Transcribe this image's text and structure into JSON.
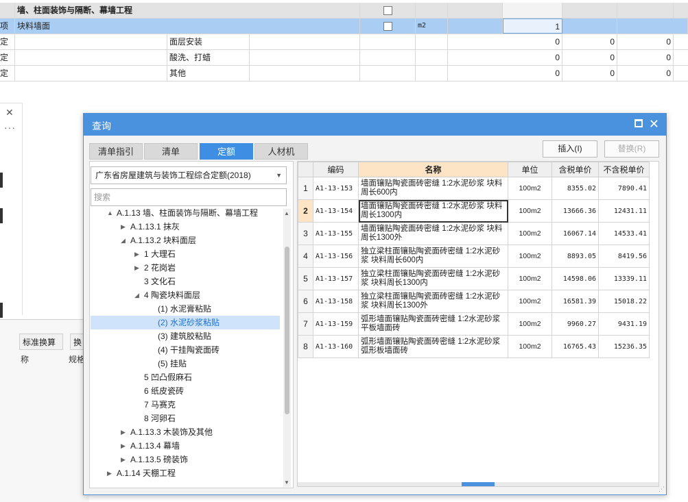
{
  "sheet": {
    "header_row": {
      "label": "墙、柱面装饰与隔断、幕墙工程"
    },
    "selected_row": {
      "type": "项",
      "name": "块料墙面",
      "unit": "m2",
      "qty": "1"
    },
    "rows": [
      {
        "type": "定",
        "desc": "面层安装",
        "v1": "0",
        "v2": "0",
        "v3": "0"
      },
      {
        "type": "定",
        "desc": "酸洗、打蜡",
        "v1": "0",
        "v2": "0",
        "v3": "0"
      },
      {
        "type": "定",
        "desc": "其他",
        "v1": "0",
        "v2": "0",
        "v3": "0"
      }
    ]
  },
  "side": {
    "close": "✕",
    "more": "···"
  },
  "bottom": {
    "tab1": "标准换算",
    "tab2": "换",
    "col1": "称",
    "col2": "规格"
  },
  "dialog": {
    "title": "查询",
    "tabs": [
      "清单指引",
      "清单",
      "定额",
      "人材机"
    ],
    "active_tab": 2,
    "insert_label": "插入(I)",
    "replace_label": "替换(R)",
    "quota_lib": "广东省房屋建筑与装饰工程综合定额(2018)",
    "search_placeholder": "搜索",
    "tree": [
      {
        "label": "A.1.13 墙、柱面装饰与隔断、幕墙工程",
        "level": 0,
        "toggle": "▲"
      },
      {
        "label": "A.1.13.1 抹灰",
        "level": 1,
        "toggle": "▶"
      },
      {
        "label": "A.1.13.2 块料面层",
        "level": 1,
        "toggle": "◢"
      },
      {
        "label": "1 大理石",
        "level": 2,
        "toggle": "▶"
      },
      {
        "label": "2 花岗岩",
        "level": 2,
        "toggle": "▶"
      },
      {
        "label": "3 文化石",
        "level": 2,
        "toggle": ""
      },
      {
        "label": "4 陶瓷块料面层",
        "level": 2,
        "toggle": "◢"
      },
      {
        "label": "(1) 水泥膏粘贴",
        "level": 3,
        "toggle": ""
      },
      {
        "label": "(2) 水泥砂浆粘贴",
        "level": 3,
        "toggle": "",
        "selected": true
      },
      {
        "label": "(3) 建筑胶粘贴",
        "level": 3,
        "toggle": ""
      },
      {
        "label": "(4) 干挂陶瓷面砖",
        "level": 3,
        "toggle": ""
      },
      {
        "label": "(5) 挂贴",
        "level": 3,
        "toggle": ""
      },
      {
        "label": "5 凹凸假麻石",
        "level": 2,
        "toggle": ""
      },
      {
        "label": "6 纸皮瓷砖",
        "level": 2,
        "toggle": ""
      },
      {
        "label": "7 马赛克",
        "level": 2,
        "toggle": ""
      },
      {
        "label": "8 河卵石",
        "level": 2,
        "toggle": ""
      },
      {
        "label": "A.1.13.3 木装饰及其他",
        "level": 1,
        "toggle": "▶"
      },
      {
        "label": "A.1.13.4 幕墙",
        "level": 1,
        "toggle": "▶"
      },
      {
        "label": "A.1.13.5 磅装饰",
        "level": 1,
        "toggle": "▶"
      },
      {
        "label": "A.1.14 天棚工程",
        "level": 0,
        "toggle": "▶"
      }
    ],
    "grid": {
      "headers": [
        "",
        "编码",
        "名称",
        "单位",
        "含税单价",
        "不含税单价"
      ],
      "rows": [
        {
          "n": "1",
          "code": "A1-13-153",
          "name": "墙面镶贴陶瓷面砖密缝 1:2水泥砂浆 块料周长600内",
          "unit": "100m2",
          "tax": "8355.02",
          "notax": "7890.41"
        },
        {
          "n": "2",
          "code": "A1-13-154",
          "name": "墙面镶贴陶瓷面砖密缝 1:2水泥砂浆 块料周长1300内",
          "unit": "100m2",
          "tax": "13666.36",
          "notax": "12431.11"
        },
        {
          "n": "3",
          "code": "A1-13-155",
          "name": "墙面镶贴陶瓷面砖密缝 1:2水泥砂浆 块料周长1300外",
          "unit": "100m2",
          "tax": "16067.14",
          "notax": "14533.41"
        },
        {
          "n": "4",
          "code": "A1-13-156",
          "name": "独立梁柱面镶贴陶瓷面砖密缝 1:2水泥砂浆 块料周长600内",
          "unit": "100m2",
          "tax": "8893.05",
          "notax": "8419.56"
        },
        {
          "n": "5",
          "code": "A1-13-157",
          "name": "独立梁柱面镶贴陶瓷面砖密缝 1:2水泥砂浆 块料周长1300内",
          "unit": "100m2",
          "tax": "14598.06",
          "notax": "13339.11"
        },
        {
          "n": "6",
          "code": "A1-13-158",
          "name": "独立梁柱面镶贴陶瓷面砖密缝 1:2水泥砂浆 块料周长1300外",
          "unit": "100m2",
          "tax": "16581.39",
          "notax": "15018.22"
        },
        {
          "n": "7",
          "code": "A1-13-159",
          "name": "弧形墙面镶贴陶瓷面砖密缝 1:2水泥砂浆 平板墙面砖",
          "unit": "100m2",
          "tax": "9960.27",
          "notax": "9431.19"
        },
        {
          "n": "8",
          "code": "A1-13-160",
          "name": "弧形墙面镶贴陶瓷面砖密缝 1:2水泥砂浆 弧形板墙面砖",
          "unit": "100m2",
          "tax": "16765.43",
          "notax": "15236.35"
        }
      ]
    }
  }
}
